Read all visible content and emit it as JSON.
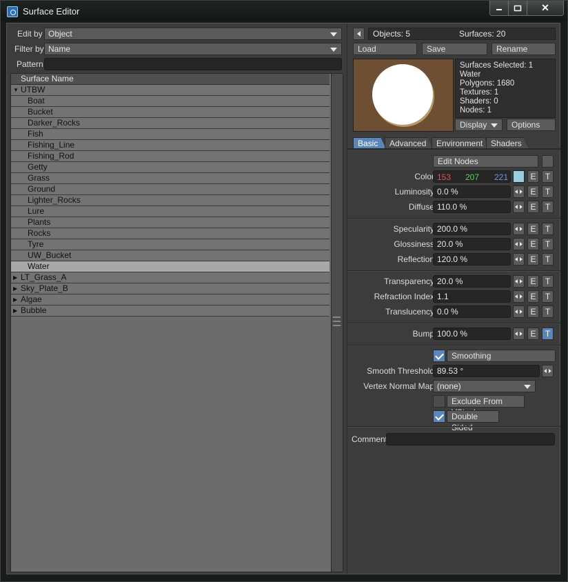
{
  "window": {
    "title": "Surface Editor",
    "close_glyph": "✕"
  },
  "left": {
    "edit_by_label": "Edit by",
    "edit_by_value": "Object",
    "filter_by_label": "Filter by",
    "filter_by_value": "Name",
    "pattern_label": "Pattern",
    "pattern_value": "",
    "list_header": "Surface Name",
    "rows": [
      {
        "label": "UTBW",
        "kind": "group",
        "expanded": true
      },
      {
        "label": "Boat",
        "kind": "child"
      },
      {
        "label": "Bucket",
        "kind": "child"
      },
      {
        "label": "Darker_Rocks",
        "kind": "child"
      },
      {
        "label": "Fish",
        "kind": "child"
      },
      {
        "label": "Fishing_Line",
        "kind": "child"
      },
      {
        "label": "Fishing_Rod",
        "kind": "child"
      },
      {
        "label": "Getty",
        "kind": "child"
      },
      {
        "label": "Grass",
        "kind": "child"
      },
      {
        "label": "Ground",
        "kind": "child"
      },
      {
        "label": "Lighter_Rocks",
        "kind": "child"
      },
      {
        "label": "Lure",
        "kind": "child"
      },
      {
        "label": "Plants",
        "kind": "child"
      },
      {
        "label": "Rocks",
        "kind": "child"
      },
      {
        "label": "Tyre",
        "kind": "child"
      },
      {
        "label": "UW_Bucket",
        "kind": "child"
      },
      {
        "label": "Water",
        "kind": "child",
        "selected": true
      },
      {
        "label": "LT_Grass_A",
        "kind": "group",
        "expanded": false
      },
      {
        "label": "Sky_Plate_B",
        "kind": "group",
        "expanded": false
      },
      {
        "label": "Algae",
        "kind": "group",
        "expanded": false
      },
      {
        "label": "Bubble",
        "kind": "group",
        "expanded": false
      }
    ]
  },
  "right": {
    "objects": "Objects: 5",
    "surfaces": "Surfaces: 20",
    "load": "Load",
    "save": "Save",
    "rename": "Rename",
    "stats": {
      "selected": "Surfaces Selected: 1",
      "name": "Water",
      "polygons": "Polygons: 1680",
      "textures": "Textures: 1",
      "shaders": "Shaders: 0",
      "nodes": "Nodes: 1"
    },
    "display": "Display",
    "options": "Options",
    "tabs": [
      "Basic",
      "Advanced",
      "Environment",
      "Shaders"
    ],
    "edit_nodes": "Edit Nodes",
    "color": {
      "label": "Color",
      "r": "153",
      "g": "207",
      "b": "221",
      "r_color": "#e05050",
      "g_color": "#5fd05f",
      "b_color": "#7c8cf0",
      "swatch": "#99cfdd"
    },
    "params": {
      "luminosity": {
        "label": "Luminosity",
        "value": "0.0 %"
      },
      "diffuse": {
        "label": "Diffuse",
        "value": "110.0 %"
      },
      "specularity": {
        "label": "Specularity",
        "value": "200.0 %"
      },
      "glossiness": {
        "label": "Glossiness",
        "value": "20.0 %"
      },
      "reflection": {
        "label": "Reflection",
        "value": "120.0 %"
      },
      "transparency": {
        "label": "Transparency",
        "value": "20.0 %"
      },
      "refraction": {
        "label": "Refraction Index",
        "value": "1.1"
      },
      "translucency": {
        "label": "Translucency",
        "value": "0.0 %"
      },
      "bump": {
        "label": "Bump",
        "value": "100.0 %"
      }
    },
    "e": "E",
    "t": "T",
    "smoothing": "Smoothing",
    "smooth_threshold": {
      "label": "Smooth Threshold",
      "value": "89.53 °"
    },
    "vertex_normal_map": {
      "label": "Vertex Normal Map",
      "value": "(none)"
    },
    "exclude_vstack": "Exclude From VStack",
    "double_sided": "Double Sided",
    "comment_label": "Comment",
    "comment_value": ""
  }
}
